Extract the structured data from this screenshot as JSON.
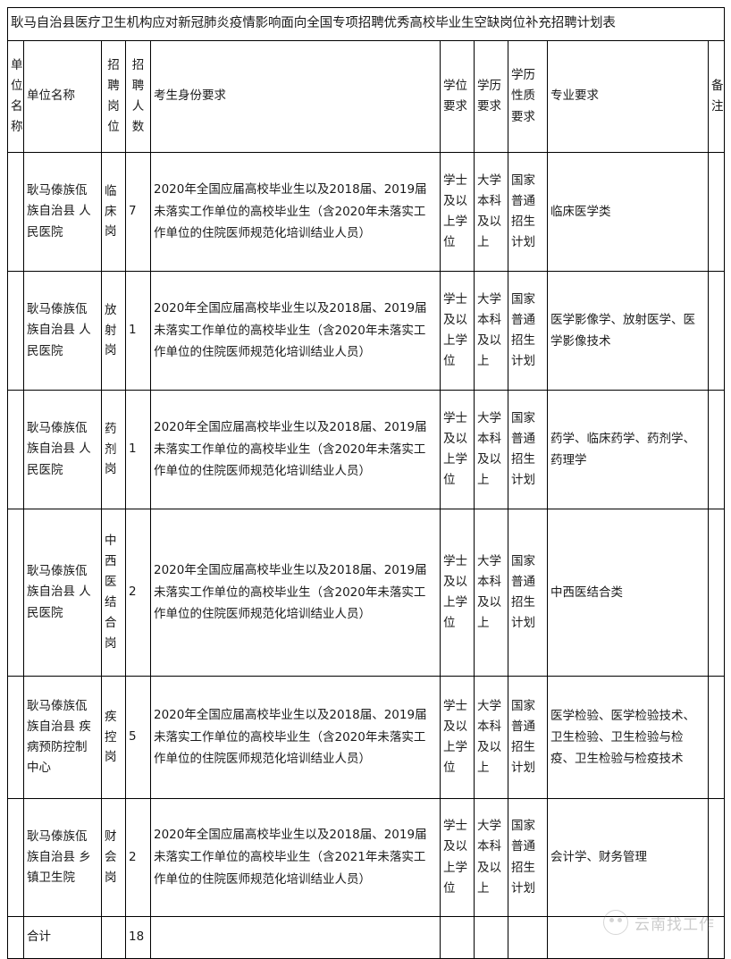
{
  "document": {
    "title": "耿马自治县医疗卫生机构应对新冠肺炎疫情影响面向全国专项招聘优秀高校毕业生空缺岗位补充招聘计划表"
  },
  "table": {
    "headers": {
      "unit_name_vertical": "单位名称",
      "unit_name": "单位名称",
      "recruit_post": "招聘岗位",
      "recruit_count": "招聘人数",
      "candidate_requirement": "考生身份要求",
      "degree_requirement": "学位要求",
      "education_requirement": "学历要求",
      "education_nature_requirement": "学历性质要求",
      "major_requirement": "专业要求",
      "remark": "备注"
    },
    "rows": [
      {
        "unit": "耿马傣族佤族自治县 人民医院",
        "post": "临床岗",
        "count": "7",
        "candidate": "2020年全国应届高校毕业生以及2018届、2019届未落实工作单位的高校毕业生（含2020年未落实工作单位的住院医师规范化培训结业人员）",
        "degree": "学士及以上学位",
        "education": "大学本科及以上",
        "nature": "国家普通招生计划",
        "major": "临床医学类",
        "remark": ""
      },
      {
        "unit": "耿马傣族佤族自治县 人民医院",
        "post": "放射岗",
        "count": "1",
        "candidate": "2020年全国应届高校毕业生以及2018届、2019届未落实工作单位的高校毕业生（含2020年未落实工作单位的住院医师规范化培训结业人员）",
        "degree": "学士及以上学位",
        "education": "大学本科及以上",
        "nature": "国家普通招生计划",
        "major": "医学影像学、放射医学、医学影像技术",
        "remark": ""
      },
      {
        "unit": "耿马傣族佤族自治县 人民医院",
        "post": "药剂岗",
        "count": "1",
        "candidate": "2020年全国应届高校毕业生以及2018届、2019届未落实工作单位的高校毕业生（含2020年未落实工作单位的住院医师规范化培训结业人员）",
        "degree": "学士及以上学位",
        "education": "大学本科及以上",
        "nature": "国家普通招生计划",
        "major": "药学、临床药学、药剂学、药理学",
        "remark": ""
      },
      {
        "unit": "耿马傣族佤族自治县 人民医院",
        "post": "中西医结合岗",
        "count": "2",
        "candidate": "2020年全国应届高校毕业生以及2018届、2019届未落实工作单位的高校毕业生（含2020年未落实工作单位的住院医师规范化培训结业人员）",
        "degree": "学士及以上学位",
        "education": "大学本科及以上",
        "nature": "国家普通招生计划",
        "major": "中西医结合类",
        "remark": ""
      },
      {
        "unit": "耿马傣族佤族自治县 疾病预防控制中心",
        "post": "疾控岗",
        "count": "5",
        "candidate": "2020年全国应届高校毕业生以及2018届、2019届未落实工作单位的高校毕业生（含2020年未落实工作单位的住院医师规范化培训结业人员）",
        "degree": "学士及以上学位",
        "education": "大学本科及以上",
        "nature": "国家普通招生计划",
        "major": "医学检验、医学检验技术、卫生检验、卫生检验与检疫、卫生检验与检疫技术",
        "remark": ""
      },
      {
        "unit": "耿马傣族佤族自治县 乡镇卫生院",
        "post": "财会岗",
        "count": "2",
        "candidate": "2020年全国应届高校毕业生以及2018届、2019届未落实工作单位的高校毕业生（含2021年未落实工作单位的住院医师规范化培训结业人员）",
        "degree": "学士及以上学位",
        "education": "大学本科及以上",
        "nature": "国家普通招生计划",
        "major": "会计学、财务管理",
        "remark": ""
      }
    ],
    "total": {
      "label": "合计",
      "count": "18"
    }
  },
  "watermark": {
    "text": "云南找工作",
    "logo_icon": "circle-face-icon"
  }
}
